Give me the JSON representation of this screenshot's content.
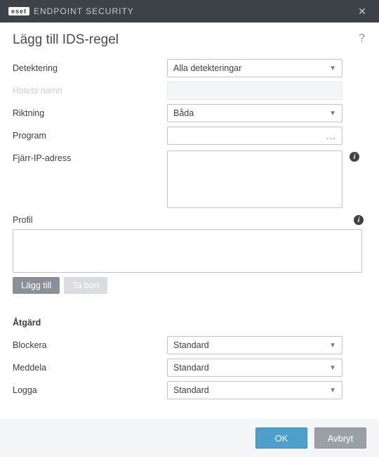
{
  "window": {
    "brand_badge": "eset",
    "brand_text": "ENDPOINT SECURITY",
    "close_glyph": "✕"
  },
  "page": {
    "title": "Lägg till IDS-regel",
    "help_glyph": "?"
  },
  "form": {
    "detektering": {
      "label": "Detektering",
      "value": "Alla detekteringar"
    },
    "hotets_namn": {
      "label": "Hotets namn",
      "value": ""
    },
    "riktning": {
      "label": "Riktning",
      "value": "Båda"
    },
    "program": {
      "label": "Program",
      "value": "",
      "browse": "..."
    },
    "fjarr_ip": {
      "label": "Fjärr-IP-adress",
      "value": ""
    }
  },
  "profil": {
    "label": "Profil",
    "value": "",
    "add_btn": "Lägg till",
    "del_btn": "Ta bort"
  },
  "atgard": {
    "heading": "Åtgärd",
    "blockera": {
      "label": "Blockera",
      "value": "Standard"
    },
    "meddela": {
      "label": "Meddela",
      "value": "Standard"
    },
    "logga": {
      "label": "Logga",
      "value": "Standard"
    }
  },
  "footer": {
    "ok": "OK",
    "cancel": "Avbryt"
  },
  "info_glyph": "i"
}
